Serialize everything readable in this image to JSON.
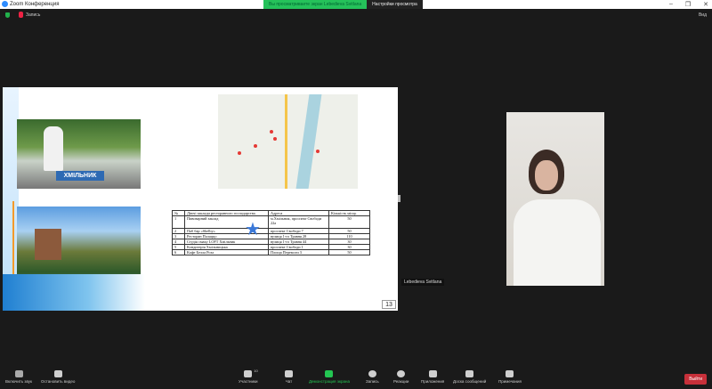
{
  "window": {
    "title": "Zoom Конференция",
    "banner": "Вы просматриваете экран Lebedieva Svitlana",
    "view_settings": "Настройки просмотра",
    "minimize": "–",
    "restore": "❐",
    "close": "✕"
  },
  "topbar": {
    "record": "Запись",
    "view": "Вид"
  },
  "slide": {
    "sign": "ХМІЛЬНИК",
    "page": "13",
    "table": {
      "headers": [
        "№",
        "Діючі заклади ресторанного господарства",
        "Адреса",
        "Кількість місць"
      ],
      "rows": [
        [
          "1",
          "Пивоварний заклад",
          "м.Хмільник, проспект Свободи 22а",
          "50"
        ],
        [
          "2",
          "Паб бар «Shelby»",
          "проспект Свободи 7",
          "50"
        ],
        [
          "3",
          "Ресторан Палаццо",
          "вулиця 1-го Травня 28",
          "110"
        ],
        [
          "4",
          "Студія смаку LOFT Хмільник",
          "вулиця 1-го Травня 44",
          "30"
        ],
        [
          "5",
          "Кондитерія Хмільницька",
          "проспект Свободи 1",
          "30"
        ],
        [
          "6",
          "Кафе Белла Роза",
          "Площа Перемоги 3",
          "50"
        ]
      ]
    }
  },
  "participant": {
    "name": "Lebedieva Svitlana"
  },
  "toolbar": {
    "unmute": "Включить звук",
    "video": "Остановить видео",
    "participants": "Участники",
    "participants_count": "10",
    "chat": "Чат",
    "share": "Демонстрация экрана",
    "record": "Запись",
    "reactions": "Реакции",
    "apps": "Приложения",
    "whiteboard": "Доска сообщений",
    "notes": "Примечания",
    "leave": "Выйти"
  },
  "colors": {
    "share": "#23c552",
    "leave": "#c7303a",
    "banner": "#25c15a"
  }
}
